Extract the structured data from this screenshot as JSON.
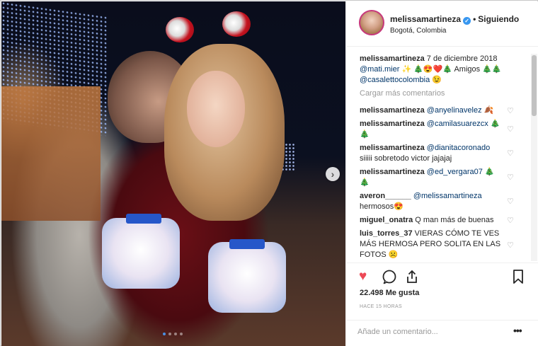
{
  "header": {
    "username": "melissamartineza",
    "verified_glyph": "✓",
    "separator": "•",
    "follow_status": "Siguiendo",
    "location": "Bogotá, Colombia"
  },
  "caption": {
    "username": "melissamartineza",
    "date": "7 de diciembre 2018",
    "mention1": "@mati.mier",
    "text": " ✨ 🎄😍❤️🎄 Amigos 🎄🎄",
    "mention2": "@casalettocolombia",
    "emoji_end": " 😉"
  },
  "load_more": "Cargar más comentarios",
  "comments": [
    {
      "user": "melissamartineza",
      "mention": "@anyelinavelez",
      "text": " 🍂"
    },
    {
      "user": "melissamartineza",
      "mention": "@camilasuarezcx",
      "text": " 🎄🎄"
    },
    {
      "user": "melissamartineza",
      "mention": "@dianitacoronado",
      "text": " siiiii sobretodo victor jajajaj"
    },
    {
      "user": "melissamartineza",
      "mention": "@ed_vergara07",
      "text": " 🎄🎄"
    },
    {
      "user": "averon______",
      "mention": "@melissamartineza",
      "text": " hermosos😍"
    },
    {
      "user": "miguel_onatra",
      "mention": "",
      "text": " Q man más de buenas"
    },
    {
      "user": "luis_torres_37",
      "mention": "",
      "text": " VIERAS CÓMO TE VES MÁS HERMOSA PERO SOLITA EN LAS FOTOS ☹️"
    }
  ],
  "actions": {
    "likes": "22.498 Me gusta",
    "time": "HACE 15 HORAS",
    "icons": [
      "heart-filled-icon",
      "comment-icon",
      "share-icon",
      "bookmark-icon"
    ],
    "like_color": "#ed4956"
  },
  "add_comment": {
    "placeholder": "Añade un comentario...",
    "more": "•••"
  },
  "photo": {
    "next_glyph": "›",
    "carousel_count": 4,
    "active_index": 0
  }
}
